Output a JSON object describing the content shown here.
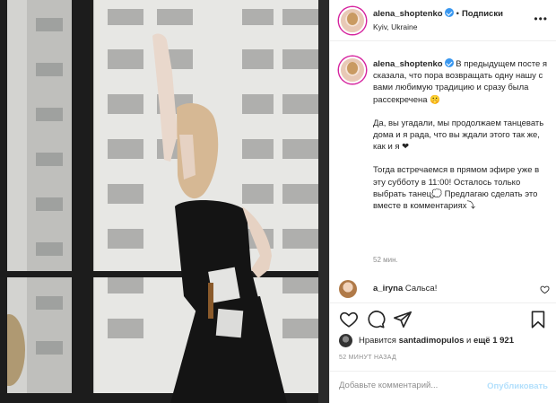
{
  "header": {
    "username": "alena_shoptenko",
    "separator": "•",
    "follow_label": "Подписки",
    "location": "Kyiv, Ukraine",
    "more_icon": "more-dots-icon"
  },
  "caption": {
    "username": "alena_shoptenko",
    "paragraphs": [
      "В предыдущем посте я сказала, что пора возвращать одну нашу с вами любимую традицию и сразу была рассекречена 🤫",
      "Да, вы угадали, мы продолжаем танцевать дома и я рада, что вы ждали этого так же, как и я ❤",
      "Тогда встречаемся в прямом эфире уже в эту субботу в 11:00! Осталось только выбрать танец💭 Предлагаю сделать это вместе в комментариях⤵"
    ],
    "time_ago": "52 мин."
  },
  "comment": {
    "username": "a_iryna",
    "text": "Сальса!"
  },
  "actions": {
    "like_icon": "heart-icon",
    "comment_icon": "comment-icon",
    "share_icon": "share-icon",
    "save_icon": "bookmark-icon"
  },
  "likes": {
    "prefix": "Нравится",
    "user": "santadimopulos",
    "conj": "и",
    "rest": "ещё 1 921"
  },
  "posted": "52 МИНУТ НАЗАД",
  "add_comment": {
    "placeholder": "Добавьте комментарий...",
    "publish_label": "Опубликовать"
  },
  "colors": {
    "verified": "#3897f0",
    "publish_disabled": "#b2dffc",
    "muted": "#8e8e8e"
  }
}
